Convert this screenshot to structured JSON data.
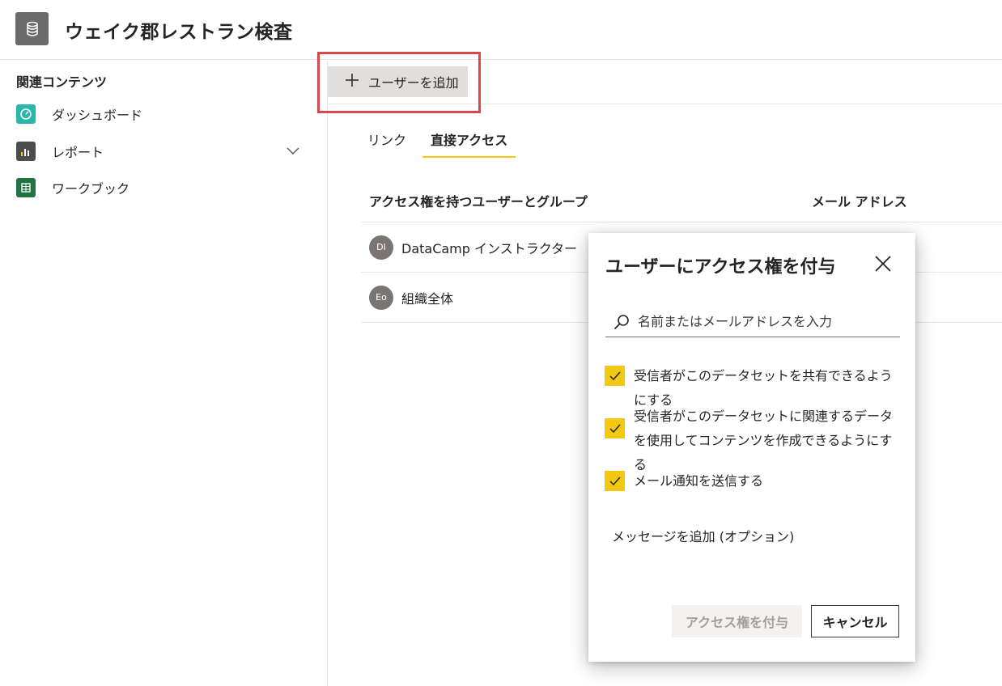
{
  "header": {
    "title": "ウェイク郡レストラン検査",
    "icon": "database-icon"
  },
  "sidebar": {
    "heading": "関連コンテンツ",
    "items": [
      {
        "label": "ダッシュボード",
        "icon": "dashboard-icon",
        "color": "#2ab7a9"
      },
      {
        "label": "レポート",
        "icon": "report-icon",
        "color": "#4d4d4d"
      },
      {
        "label": "ワークブック",
        "icon": "excel-icon",
        "color": "#217346"
      }
    ]
  },
  "toolbar": {
    "add_user_label": "ユーザーを追加",
    "highlight_color": "#d9474b"
  },
  "tabs": [
    {
      "label": "リンク",
      "active": false
    },
    {
      "label": "直接アクセス",
      "active": true
    }
  ],
  "table": {
    "headers": [
      "アクセス権を持つユーザーとグループ",
      "メール アドレス"
    ],
    "rows": [
      {
        "initials": "DI",
        "name": "DataCamp インストラクター"
      },
      {
        "initials": "Eo",
        "name": "組織全体"
      }
    ]
  },
  "dialog": {
    "title": "ユーザーにアクセス権を付与",
    "search_placeholder": "名前またはメールアドレスを入力",
    "checkboxes": [
      {
        "label": "受信者がこのデータセットを共有できるようにする",
        "checked": true
      },
      {
        "label": "受信者がこのデータセットに関連するデータを使用してコンテンツを作成できるようにする",
        "checked": true
      },
      {
        "label": "メール通知を送信する",
        "checked": true
      }
    ],
    "message_link": "メッセージを追加 (オプション)",
    "grant_button": "アクセス権を付与",
    "cancel_button": "キャンセル",
    "accent_color": "#f2c811"
  }
}
